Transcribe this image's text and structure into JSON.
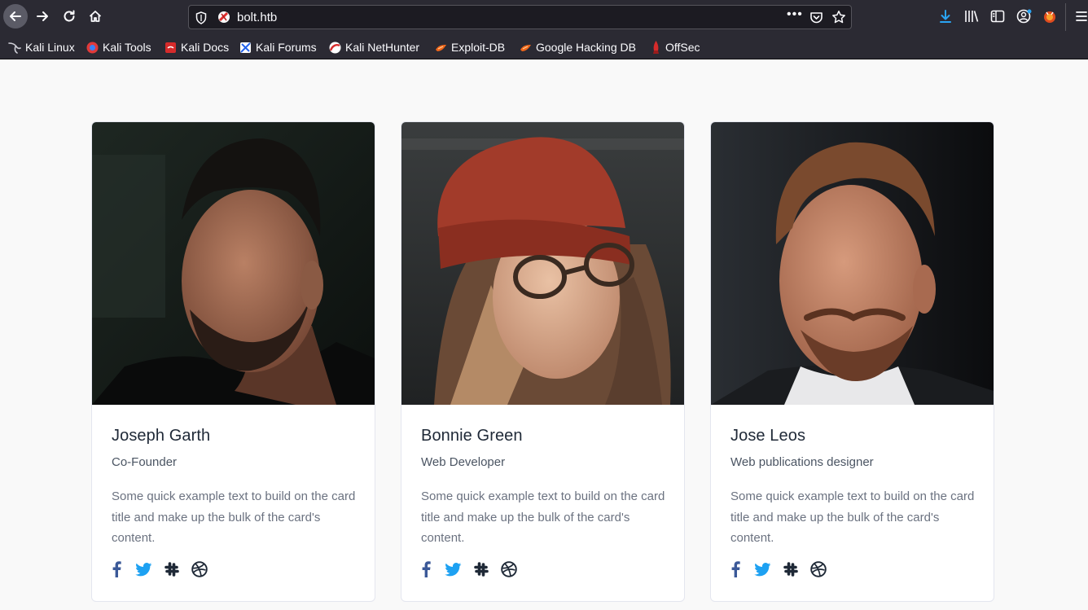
{
  "browser": {
    "url": "bolt.htb",
    "bookmarks": [
      {
        "label": "Kali Linux"
      },
      {
        "label": "Kali Tools"
      },
      {
        "label": "Kali Docs"
      },
      {
        "label": "Kali Forums"
      },
      {
        "label": "Kali NetHunter"
      },
      {
        "label": "Exploit-DB"
      },
      {
        "label": "Google Hacking DB"
      },
      {
        "label": "OffSec"
      }
    ]
  },
  "team": [
    {
      "name": "Joseph Garth",
      "role": "Co-Founder",
      "text": "Some quick example text to build on the card title and make up the bulk of the card's content."
    },
    {
      "name": "Bonnie Green",
      "role": "Web Developer",
      "text": "Some quick example text to build on the card title and make up the bulk of the card's content."
    },
    {
      "name": "Jose Leos",
      "role": "Web publications designer",
      "text": "Some quick example text to build on the card title and make up the bulk of the card's content."
    }
  ],
  "social_icons": [
    "facebook-icon",
    "twitter-icon",
    "slack-icon",
    "dribbble-icon"
  ],
  "colors": {
    "facebook": "#3b5998",
    "twitter": "#1da1f2",
    "slack": "#1f2937",
    "dribbble": "#1f2937",
    "chrome_bg": "#2b2a33",
    "page_bg": "#f9f9f9"
  }
}
